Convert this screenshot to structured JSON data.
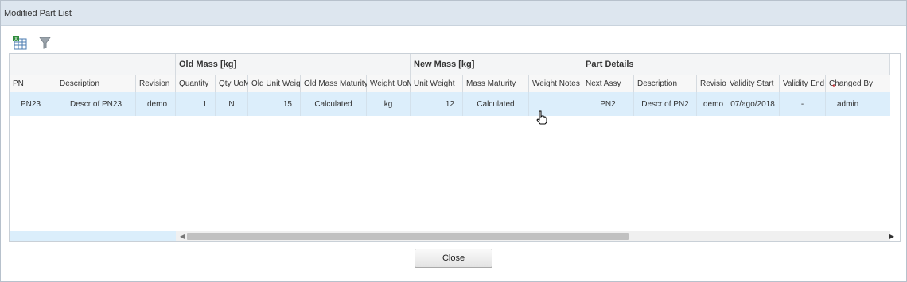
{
  "dialog": {
    "title": "Modified Part List"
  },
  "toolbar": {
    "export_icon": "excel-export-icon",
    "filter_icon": "filter-icon"
  },
  "groups": [
    {
      "label": ""
    },
    {
      "label": "Old Mass [kg]"
    },
    {
      "label": "New Mass [kg]"
    },
    {
      "label": "Part Details"
    }
  ],
  "columns": [
    {
      "label": "PN"
    },
    {
      "label": "Description"
    },
    {
      "label": "Revision"
    },
    {
      "label": "Quantity"
    },
    {
      "label": "Qty UoM"
    },
    {
      "label": "Old Unit Weight"
    },
    {
      "label": "Old Mass Maturity"
    },
    {
      "label": "Weight UoM"
    },
    {
      "label": "Unit Weight"
    },
    {
      "label": "Mass Maturity"
    },
    {
      "label": "Weight Notes"
    },
    {
      "label": "Next Assy"
    },
    {
      "label": "Description"
    },
    {
      "label": "Revision"
    },
    {
      "label": "Validity Start"
    },
    {
      "label": "Validity End"
    },
    {
      "label": "Changed By",
      "required": "*"
    }
  ],
  "rows": [
    [
      "PN23",
      "Descr of PN23",
      "demo",
      "1",
      "N",
      "15",
      "Calculated",
      "kg",
      "12",
      "Calculated",
      "",
      "PN2",
      "Descr of PN2",
      "demo",
      "07/ago/2018",
      "-",
      "admin"
    ]
  ],
  "footer": {
    "close_label": "Close"
  },
  "colors": {
    "selected_row": "#dceefb",
    "titlebar": "#dde6ef"
  }
}
